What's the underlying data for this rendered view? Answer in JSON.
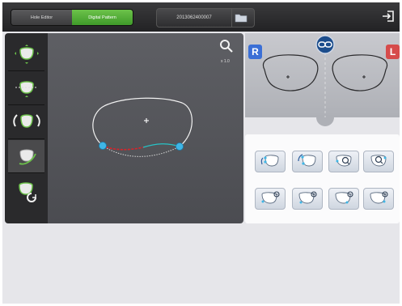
{
  "header": {
    "tabs": [
      {
        "label": "Hole Editor",
        "active": false
      },
      {
        "label": "Digital Pattern",
        "active": true
      }
    ],
    "pattern_number": "2013062400007",
    "icons": {
      "folder": "folder-icon",
      "exit": "exit-icon"
    }
  },
  "sidebar": {
    "items": [
      {
        "icon": "resize-lens-icon",
        "active": false
      },
      {
        "icon": "bevel-position-icon",
        "active": false
      },
      {
        "icon": "rotate-lens-icon",
        "active": false
      },
      {
        "icon": "edit-shape-icon",
        "active": true
      },
      {
        "icon": "restore-shape-icon",
        "active": false
      }
    ]
  },
  "canvas": {
    "zoom_label": "x 1.0",
    "icons": {
      "zoom": "magnifier-icon"
    }
  },
  "lens_panel": {
    "right_label": "R",
    "left_label": "L",
    "icons": {
      "link": "link-icon"
    },
    "colors": {
      "right": "#3b6fd6",
      "left": "#d64b4b"
    }
  },
  "tools": {
    "row1": [
      "select-point-icon",
      "move-point-icon",
      "zoom-point-icon",
      "zoom-center-icon"
    ],
    "row2": [
      "zoom-bottom-left-icon",
      "zoom-bottom-mid-icon",
      "zoom-bottom-right-icon",
      "zoom-bottom-far-icon"
    ]
  },
  "colors": {
    "accent": "#6cc24a",
    "handle": "#3fb6e6",
    "edit_red": "#d8232a",
    "edit_cyan": "#27c3c6"
  }
}
